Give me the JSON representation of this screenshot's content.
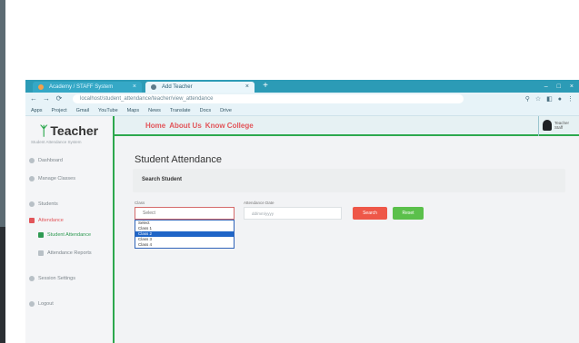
{
  "browser": {
    "tabs": [
      {
        "label": "Academy / STAFF System",
        "icon": "app-icon"
      },
      {
        "label": "Add Teacher",
        "icon": "page-icon"
      }
    ],
    "new_tab": "+",
    "window_controls": [
      "–",
      "□",
      "×"
    ],
    "url": "localhost/student_attendance/teacher/view_attendance",
    "bookmarks": [
      "Apps",
      "Project",
      "Gmail",
      "YouTube",
      "Maps",
      "News",
      "Translate",
      "Docs",
      "Drive"
    ]
  },
  "sidebar": {
    "brand": "Teacher",
    "brand_sub": "Student Attendance System",
    "items": [
      {
        "label": "Dashboard",
        "active": false
      },
      {
        "label": "Manage Classes",
        "active": false
      },
      {
        "label": "Students",
        "active": false
      },
      {
        "label": "Attendance",
        "active": true
      },
      {
        "label": "Student Attendance",
        "sub": true
      },
      {
        "label": "Attendance Reports",
        "sub": true
      },
      {
        "label": "Session Settings",
        "active": false
      },
      {
        "label": "Logout",
        "active": false
      }
    ]
  },
  "topbar": {
    "links": [
      "Home",
      "About Us",
      "Know College"
    ],
    "user_name": "Teacher",
    "user_role": "Staff"
  },
  "main": {
    "title": "Student Attendance",
    "card_title": "Search Student",
    "class_label": "Class",
    "class_value": "Select",
    "class_options": [
      "Select",
      "Class 1",
      "Class 2",
      "Class 3",
      "Class 4"
    ],
    "selected_index": 2,
    "date_label": "Attendance Date",
    "date_placeholder": "dd/mm/yyyy",
    "search_button": "Search",
    "reset_button": "Reset"
  },
  "colors": {
    "brand_green": "#2da84e",
    "accent_red": "#e2555a",
    "tab_bar": "#2c9bb6",
    "search_button": "#ee5748",
    "reset_button": "#5bc04b"
  }
}
